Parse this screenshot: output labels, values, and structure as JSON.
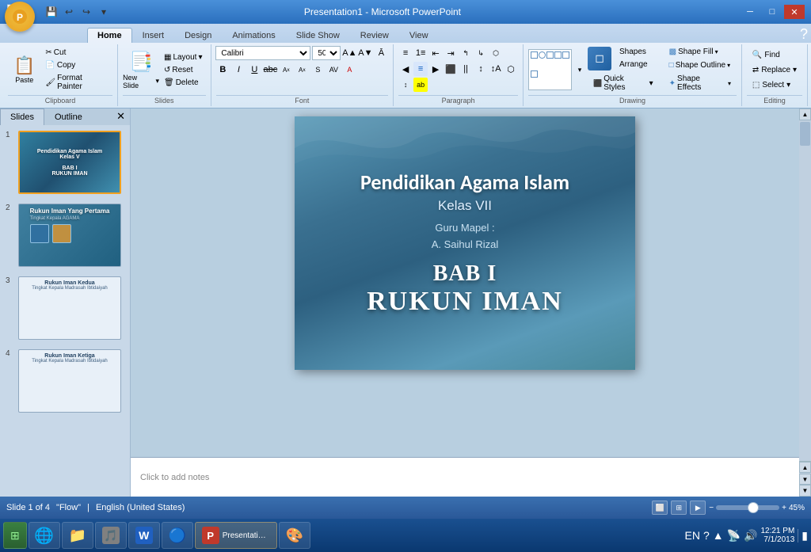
{
  "window": {
    "title": "Presentation1 - Microsoft PowerPoint",
    "min_btn": "─",
    "max_btn": "□",
    "close_btn": "✕"
  },
  "ribbon": {
    "tabs": [
      "Home",
      "Insert",
      "Design",
      "Animations",
      "Slide Show",
      "Review",
      "View"
    ],
    "active_tab": "Home",
    "groups": {
      "clipboard": {
        "label": "Clipboard",
        "paste": "Paste",
        "cut": "Cut",
        "copy": "Copy",
        "format_painter": "Format Painter"
      },
      "slides": {
        "label": "Slides",
        "new_slide": "New Slide",
        "layout": "Layout",
        "reset": "Reset",
        "delete": "Delete"
      },
      "font": {
        "label": "Font",
        "font_name": "Calibri",
        "font_size": "50",
        "bold": "B",
        "italic": "I",
        "underline": "U",
        "strikethrough": "abc",
        "subscript": "A",
        "superscript": "A"
      },
      "paragraph": {
        "label": "Paragraph"
      },
      "drawing": {
        "label": "Drawing",
        "shapes_btn": "Shapes",
        "arrange_btn": "Arrange",
        "quick_styles": "Quick Styles",
        "shape_fill": "Shape Fill",
        "shape_outline": "Shape Outline",
        "shape_effects": "Shape Effects"
      },
      "editing": {
        "label": "Editing",
        "find": "Find",
        "replace": "Replace",
        "select": "Select"
      }
    }
  },
  "slides_panel": {
    "tabs": [
      "Slides",
      "Outline"
    ],
    "slides": [
      {
        "num": "1",
        "title": "Pendidikan Agama Islam",
        "subtitle": "Kelas V",
        "bab": "BAB I",
        "rukun": "RUKUN IMAN",
        "selected": true
      },
      {
        "num": "2",
        "title": "Rukun Iman Yang Pertama",
        "subtitle": "Tingkat Kepala AGAMA",
        "selected": false
      },
      {
        "num": "3",
        "title": "Rukun Iman Kedua",
        "subtitle": "Tingkat Kepala Madrasah Ibtidaiyah",
        "selected": false
      },
      {
        "num": "4",
        "title": "Rukun Iman Ketiga",
        "subtitle": "Tingkat Kepala Madrasah Ibtidaiyah",
        "selected": false
      }
    ]
  },
  "main_slide": {
    "line1": "Pendidikan Agama Islam",
    "line2": "Kelas VII",
    "line3": "Guru Mapel :",
    "line4": "A. Saihul Rizal",
    "line5": "BAB I",
    "line6": "RUKUN IMAN"
  },
  "notes": {
    "placeholder": "Click to add notes"
  },
  "status_bar": {
    "slide_info": "Slide 1 of 4",
    "theme": "\"Flow\"",
    "language": "English (United States)",
    "zoom": "45%"
  },
  "taskbar": {
    "items": [
      {
        "name": "ie",
        "icon": "🌐",
        "label": ""
      },
      {
        "name": "explorer",
        "icon": "📁",
        "label": ""
      },
      {
        "name": "media",
        "icon": "🎵",
        "label": ""
      },
      {
        "name": "word",
        "icon": "W",
        "label": ""
      },
      {
        "name": "chrome",
        "icon": "🔵",
        "label": ""
      },
      {
        "name": "powerpoint",
        "icon": "P",
        "label": ""
      },
      {
        "name": "paint",
        "icon": "🎨",
        "label": ""
      }
    ],
    "time": "12:21 PM",
    "date": "7/1/2013"
  }
}
